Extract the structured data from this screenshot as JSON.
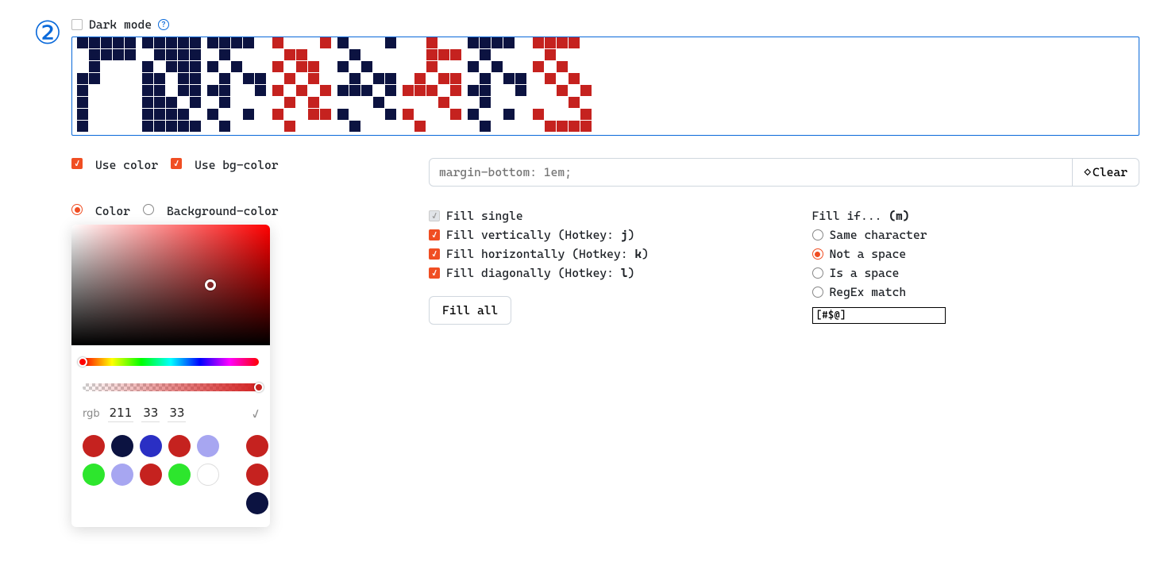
{
  "step_number": "②",
  "dark_mode": {
    "label": "Dark mode",
    "checked": false
  },
  "preview_letters": [
    {
      "color": "n",
      "grid": "...#...###..####.#.#..#.#..#.#..#.#.."
    },
    {
      "color": "n",
      "grid": "..###.###..#####.####..####..###.###."
    },
    {
      "color": "n",
      "grid": "..###.####.#.#.#.####.####..####.#.#."
    },
    {
      "color": "r",
      "grid": ".###..#..#.#..#.#..#.#..#.#..#.#..#.#"
    },
    {
      "color": "n",
      "grid": "..#...###..#.#.#######.#..#.#..#.#..#"
    },
    {
      "color": "r",
      "grid": "..#....#....####.####.##############.#"
    },
    {
      "color": "n",
      "grid": "..#....#....####.####.##############.#"
    },
    {
      "color": "r",
      "grid": ".###..#..#.#..#.#..#.#..#.#..#.#..#.."
    }
  ],
  "use_color": {
    "label": "Use color",
    "checked": true
  },
  "use_bg": {
    "label": "Use bg-color",
    "checked": true
  },
  "mode_radio": {
    "color_label": "Color",
    "bg_label": "Background-color",
    "selected": "color"
  },
  "rgb": {
    "label": "rgb",
    "r": "211",
    "g": "33",
    "b": "33"
  },
  "swatches": [
    "#c5221f",
    "#0c1341",
    "#2a2fc4",
    "#c5221f",
    "#a7a6f1",
    "#c5221f",
    "#2de62d",
    "#a7a6f1",
    "#c5221f",
    "#2de62d",
    "#ffffff",
    "#c5221f",
    "#0c1341"
  ],
  "css_input": {
    "placeholder": "margin-bottom: 1em;"
  },
  "clear_label": "Clear",
  "fills": {
    "single": "Fill single",
    "vertical_pre": "Fill vertically (Hotkey: ",
    "vertical_key": "j",
    "horizontal_pre": "Fill horizontally (Hotkey: ",
    "horizontal_key": "k",
    "diagonal_pre": "Fill diagonally (Hotkey: ",
    "diagonal_key": "l"
  },
  "fill_all": "Fill all",
  "fill_if": {
    "title_pre": "Fill if... ",
    "title_key": "(m)",
    "opts": {
      "same": "Same character",
      "not_space": "Not a space",
      "is_space": "Is a space",
      "regex": "RegEx match"
    },
    "selected": "not_space",
    "regex_value": "[#$@]"
  }
}
